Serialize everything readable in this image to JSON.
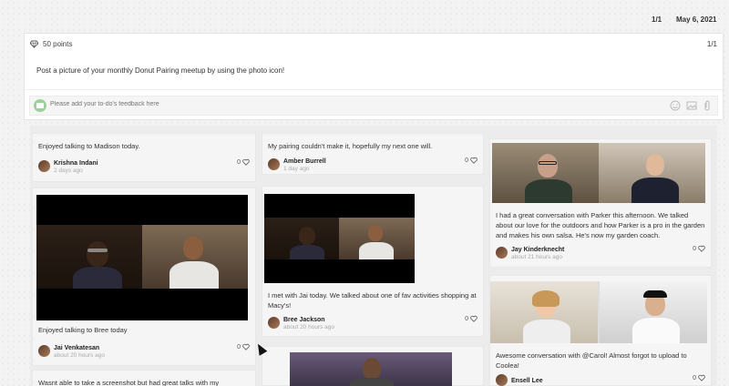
{
  "header": {
    "page": "1/1",
    "date": "May 6, 2021"
  },
  "task": {
    "points": "50 points",
    "page": "1/1",
    "prompt": "Post a picture of your monthly Donut Pairing meetup by using the photo icon!",
    "feedback_placeholder": "Please add your to-do's feedback here"
  },
  "posts": {
    "c1_p1": {
      "text": "Enjoyed talking to Madison today.",
      "name": "Krishna Indani",
      "ago": "2 days ago",
      "likes": "0"
    },
    "c1_p2": {
      "text": "Enjoyed talking to Bree today",
      "name": "Jai Venkatesan",
      "ago": "about 20 hours ago",
      "likes": "0"
    },
    "c1_p3": {
      "text": "Wasnt able to take a screenshot but had great talks with my"
    },
    "c2_p1": {
      "text": "My pairing couldn't make it, hopefully my next one will.",
      "name": "Amber Burrell",
      "ago": "1 day ago",
      "likes": "0"
    },
    "c2_p2": {
      "text": "I met with Jai today. We talked about one of fav activities shopping at Macy's!",
      "name": "Bree Jackson",
      "ago": "about 20 hours ago",
      "likes": "0"
    },
    "c3_p1": {
      "text": "I had a great conversation with Parker this afternoon. We talked about our love for the outdoors and how Parker is a pro in the garden and makes his own salsa.  He's now my garden coach.",
      "name": "Jay Kinderknecht",
      "ago": "about 21 hours ago",
      "likes": "0"
    },
    "c3_p2": {
      "text": "Awesome conversation with @Carol! Almost forgot to upload to Coolea!",
      "name": "Ensell Lee",
      "likes": "0"
    }
  }
}
